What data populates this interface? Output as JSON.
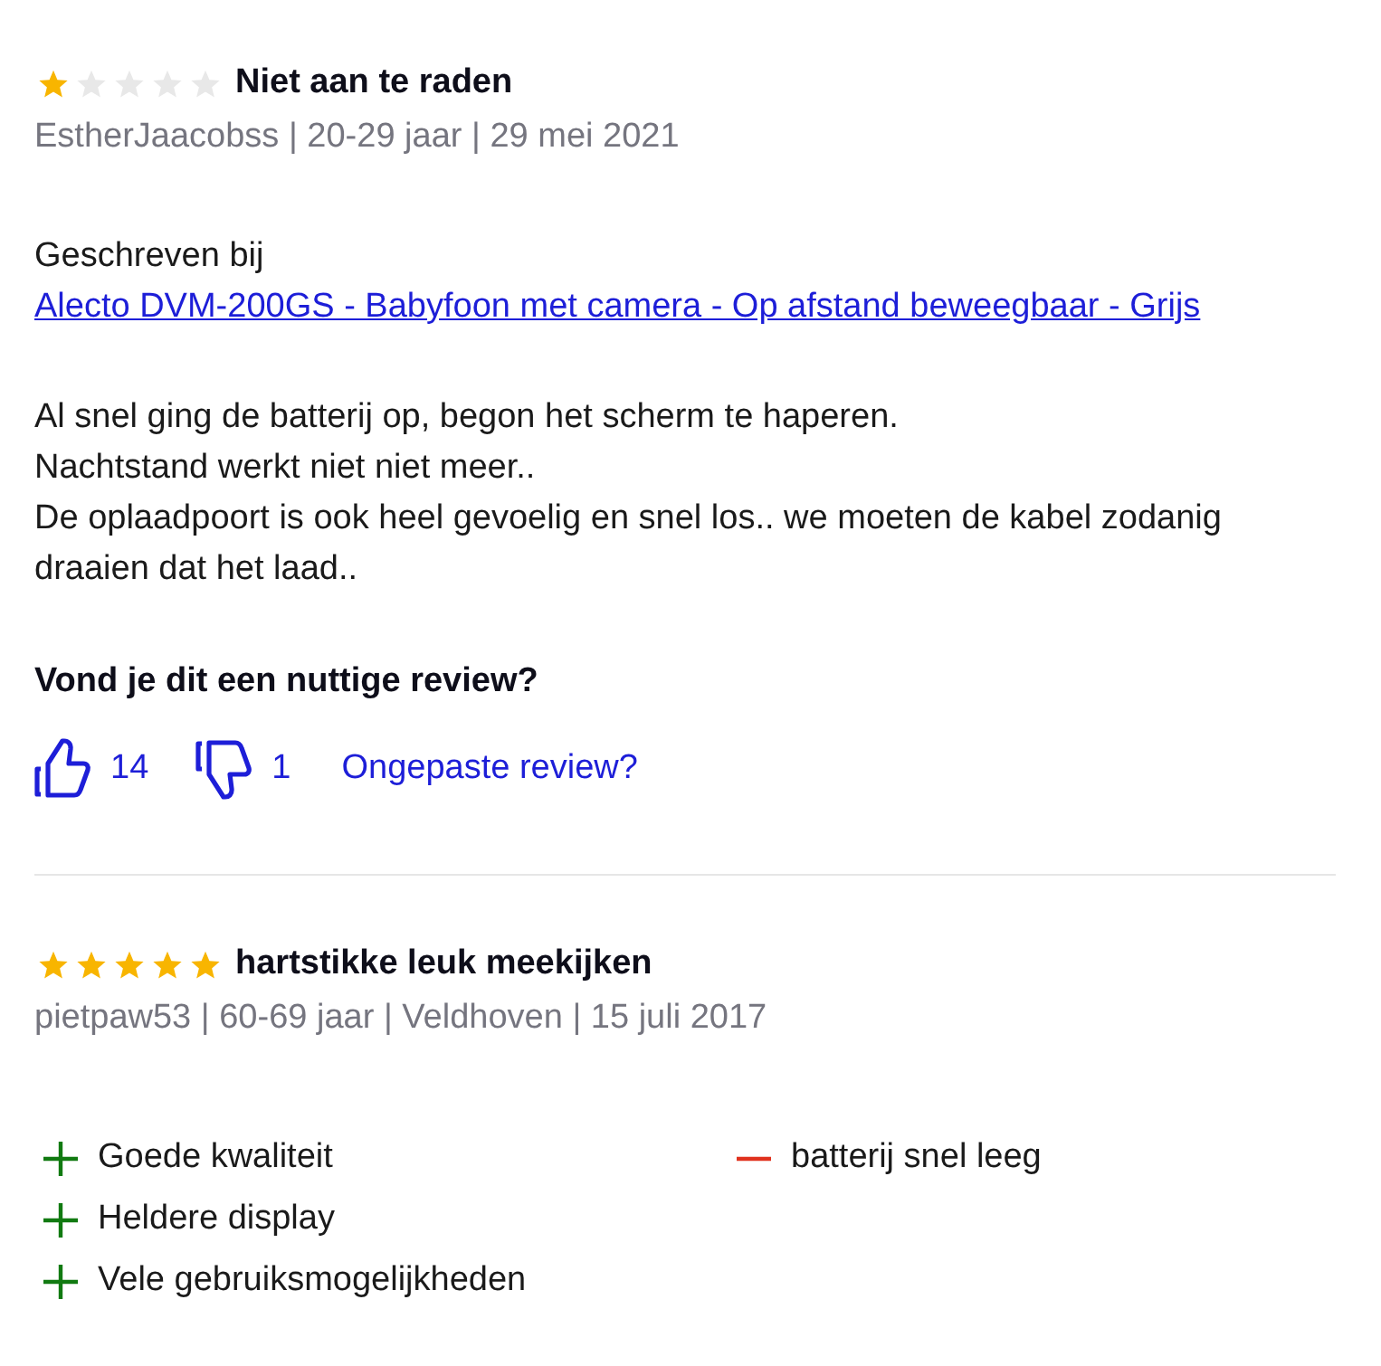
{
  "reviews": [
    {
      "stars": 1,
      "title": "Niet aan te raden",
      "meta": "EstherJaacobss | 20-29 jaar | 29 mei 2021",
      "written_for": {
        "prefix": "Geschreven bij",
        "link": "Alecto DVM-200GS - Babyfoon met camera - Op afstand beweegbaar - Grijs"
      },
      "body": [
        "Al snel ging de batterij op, begon het scherm te haperen.",
        "Nachtstand werkt niet niet meer..",
        "De oplaadpoort is ook heel gevoelig en snel los.. we moeten de kabel zodanig draaien dat het laad.."
      ],
      "helpful": {
        "question": "Vond je dit een nuttige review?",
        "up": "14",
        "down": "1",
        "report": "Ongepaste review?"
      }
    },
    {
      "stars": 5,
      "title": "hartstikke leuk meekijken",
      "meta": "pietpaw53 | 60-69 jaar | Veldhoven | 15 juli 2017",
      "pros": [
        "Goede kwaliteit",
        "Heldere display",
        "Vele gebruiksmogelijkheden"
      ],
      "cons": [
        "batterij snel leeg"
      ]
    }
  ]
}
